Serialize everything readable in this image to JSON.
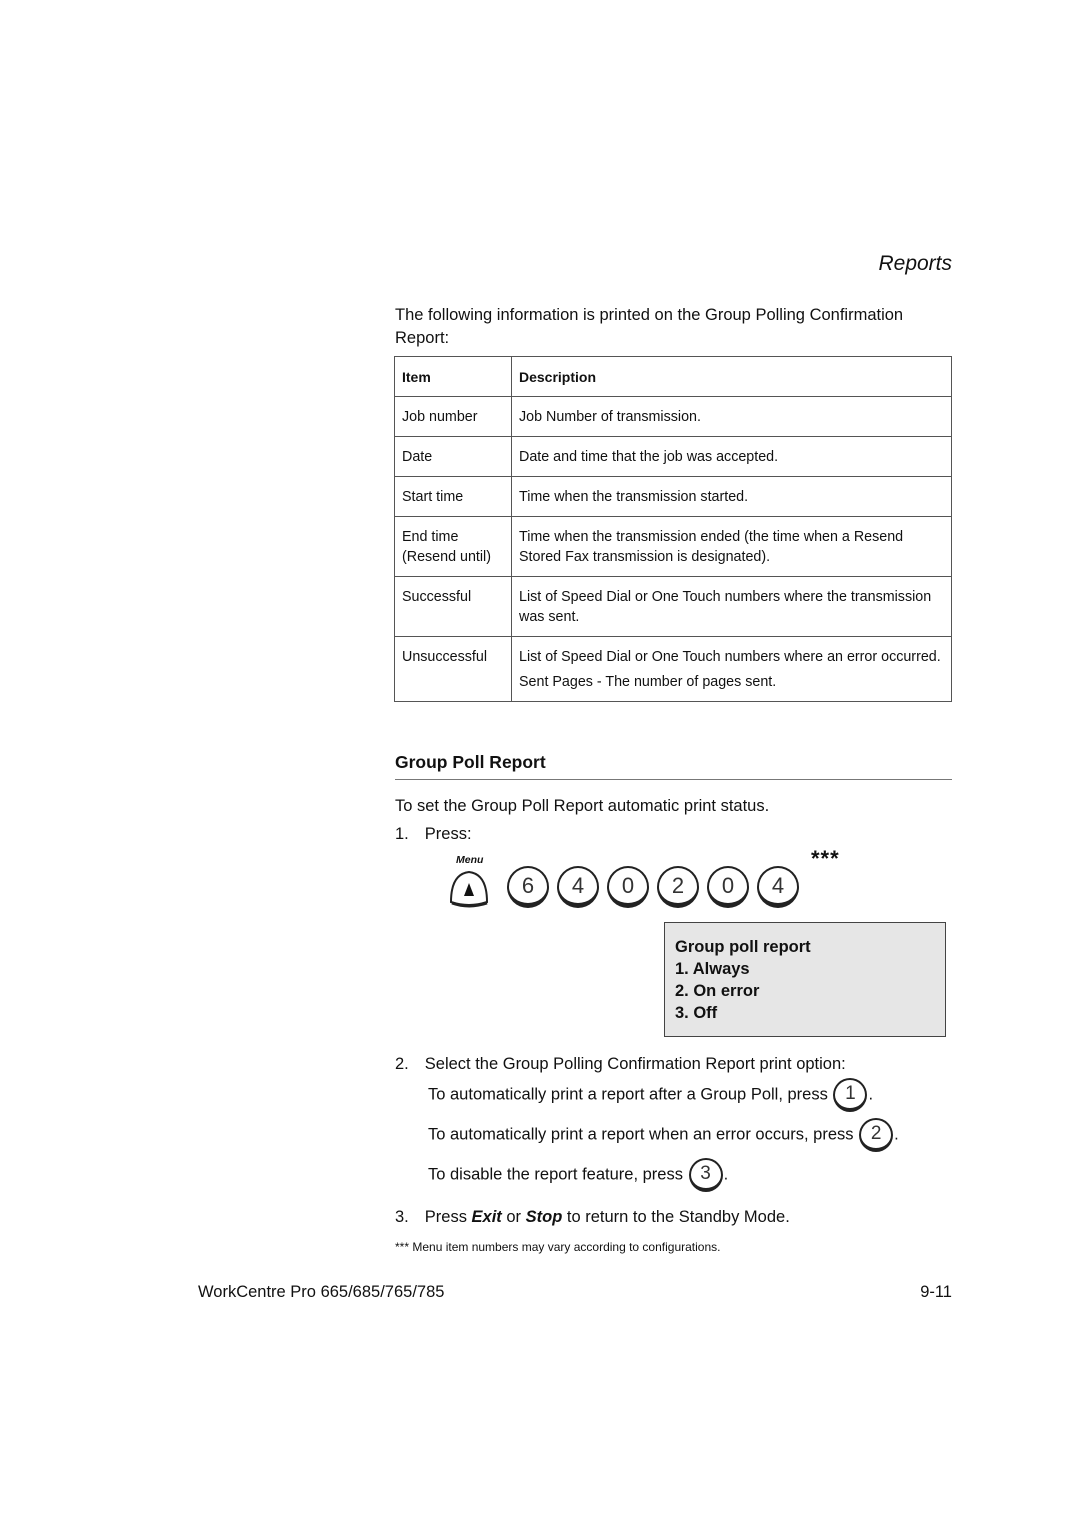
{
  "header": {
    "section_title": "Reports"
  },
  "intro": "The following information is printed on the Group Polling Confirmation Report:",
  "table": {
    "headers": [
      "Item",
      "Description"
    ],
    "rows": [
      {
        "item": "Job number",
        "description": "Job Number of transmission."
      },
      {
        "item": "Date",
        "description": "Date and time that the job was accepted."
      },
      {
        "item": "Start time",
        "description": "Time when the transmission started."
      },
      {
        "item": "End time (Resend until)",
        "description": "Time when the transmission ended (the time when a Resend Stored Fax transmission is designated)."
      },
      {
        "item": "Successful",
        "description": "List of Speed Dial or One Touch numbers where the transmission was sent."
      },
      {
        "item": "Unsuccessful",
        "description": "List of Speed Dial or One Touch numbers where an error occurred.",
        "extra": "Sent Pages - The number of pages sent."
      }
    ]
  },
  "group_poll": {
    "heading": "Group Poll Report",
    "intro": "To set the Group Poll Report automatic print status.",
    "step1": {
      "num": "1.",
      "text": "Press:"
    },
    "key_sequence": {
      "menu_label": "Menu",
      "keys": [
        "6",
        "4",
        "0",
        "2",
        "0",
        "4"
      ],
      "marker": "***"
    },
    "display": {
      "title": "Group poll report",
      "options": [
        "1. Always",
        "2. On error",
        "3. Off"
      ]
    },
    "step2": {
      "num": "2.",
      "text": "Select the Group Polling Confirmation Report print option:",
      "options": [
        {
          "text": "To automatically print a report after a Group Poll, press",
          "key": "1"
        },
        {
          "text": "To automatically print a report when an error occurs, press",
          "key": "2"
        },
        {
          "text": "To disable the report feature, press",
          "key": "3"
        }
      ]
    },
    "step3": {
      "num": "3.",
      "pre": "Press ",
      "exit": "Exit",
      "mid": " or ",
      "stop": "Stop",
      "post": " to return to the Standby Mode."
    },
    "note": "*** Menu item numbers may vary according to configurations."
  },
  "footer": {
    "product": "WorkCentre Pro 665/685/765/785",
    "page": "9-11"
  }
}
